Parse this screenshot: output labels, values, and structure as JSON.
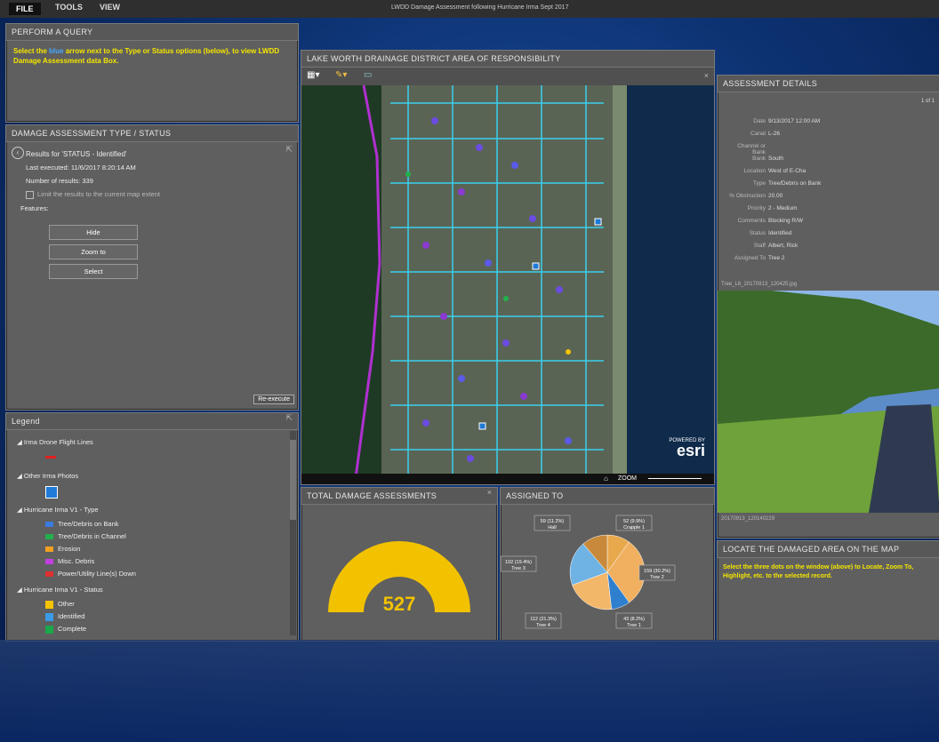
{
  "menu": {
    "items": [
      "FILE",
      "TOOLS",
      "VIEW"
    ]
  },
  "app_title": "LWDD Damage Assessment following Hurricane Irma Sept 2017",
  "query_panel": {
    "title": "PERFORM A QUERY",
    "instruction_pre": "Select the ",
    "instruction_blue": "blue",
    "instruction_post": " arrow next to the Type or Status options (below), to view LWDD Damage Assessment data Box."
  },
  "type_status_panel": {
    "title": "DAMAGE ASSESSMENT TYPE / STATUS",
    "results_for": "Results for 'STATUS - Identified'",
    "last_executed": "Last executed:  11/6/2017 8:20:14 AM",
    "number_of_results": "Number of results:  339",
    "limit_checkbox": "Limit the results to the current map extent",
    "features_label": "Features:",
    "hide_btn": "Hide",
    "zoom_btn": "Zoom to",
    "select_btn": "Select",
    "reexecute_btn": "Re-execute"
  },
  "legend": {
    "title": "Legend",
    "groups": [
      {
        "label": "Irma Drone Flight Lines"
      },
      {
        "label": "Other Irma Photos"
      },
      {
        "label": "Hurricane Irma V1 - Type",
        "items": [
          "Tree/Debris on Bank",
          "Tree/Debris in Channel",
          "Erosion",
          "Misc. Debris",
          "Power/Utility Line(s) Down"
        ]
      },
      {
        "label": "Hurricane Irma V1 - Status",
        "items": [
          "Other",
          "Identified",
          "Complete"
        ]
      }
    ],
    "type_colors": [
      "#3a7be0",
      "#22b14c",
      "#f0a020",
      "#c040e0",
      "#e03030"
    ],
    "status_colors": [
      "#f5c400",
      "#3a9be8",
      "#1aa84a"
    ]
  },
  "map_panel": {
    "title": "LAKE WORTH DRAINAGE DISTRICT AREA OF RESPONSIBILITY",
    "zoom_label": "ZOOM",
    "powered_by": "POWERED BY",
    "esri": "esri"
  },
  "total_panel": {
    "title": "TOTAL DAMAGE ASSESSMENTS",
    "value": "527",
    "gauge_color": "#f2c200",
    "gauge_fraction": 1.0
  },
  "assigned_panel": {
    "title": "ASSIGNED TO",
    "chart_data": {
      "type": "pie",
      "labels": [
        "Crapple 1",
        "Tree 2",
        "Tree 1",
        "Tree 4",
        "Tree 3",
        "Hall"
      ],
      "values": [
        52,
        159,
        43,
        112,
        102,
        59
      ],
      "display": [
        "52 (9.9%)",
        "159 (30.2%)",
        "43 (8.2%)",
        "112 (21.3%)",
        "102 (19.4%)",
        "59 (11.2%)"
      ],
      "colors": [
        "#e8a84c",
        "#f0b060",
        "#2f7fcf",
        "#f3b76a",
        "#6fb3e4",
        "#c88a3a"
      ]
    }
  },
  "details_panel": {
    "title": "ASSESSMENT DETAILS",
    "pager": "1 of 1",
    "rows": [
      {
        "k": "Date",
        "v": "9/13/2017 12:00 AM"
      },
      {
        "k": "Canal",
        "v": "L-26"
      },
      {
        "k": "Channel or Bank",
        "v": ""
      },
      {
        "k": "Bank",
        "v": "South"
      },
      {
        "k": "Location",
        "v": "West of E-Cha"
      },
      {
        "k": "Type",
        "v": "Tree/Debris on Bank"
      },
      {
        "k": "% Obstruction",
        "v": "20.00"
      },
      {
        "k": "Priority",
        "v": "2 - Medium"
      },
      {
        "k": "Comments",
        "v": "Blocking R/W"
      },
      {
        "k": "Status",
        "v": "Identified"
      },
      {
        "k": "Staff",
        "v": "Albert, Rick"
      },
      {
        "k": "Assigned To",
        "v": "Tree 2"
      }
    ],
    "photo_caption": "Tree_L8_20170913_120425.jpg",
    "photo_footer": "20170913_120140229"
  },
  "locate_panel": {
    "title": "LOCATE THE DAMAGED AREA ON THE MAP",
    "text": "Select the three dots on the window (above) to Locate, Zoom To, Highlight, etc. to the selected record."
  }
}
